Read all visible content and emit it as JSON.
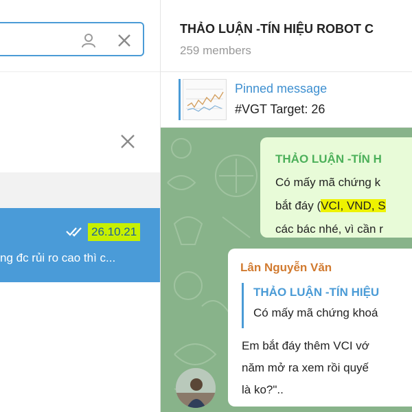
{
  "sidebar": {
    "search": {
      "value": "",
      "placeholder": ""
    },
    "chat_item": {
      "date": "26.10.21",
      "preview": "ng đc rủi ro cao thì c..."
    }
  },
  "chat": {
    "title": "THẢO LUẬN -TÍN HIỆU ROBOT C",
    "members": "259 members",
    "pinned": {
      "label": "Pinned message",
      "text": "#VGT Target: 26"
    },
    "message1": {
      "sender": "THẢO LUẬN -TÍN H",
      "line1": "Có mấy mã chứng k",
      "line2_pre": "bắt đáy (",
      "line2_hl": "VCI, VND, S",
      "line3": "các bác nhé, vì cần r"
    },
    "message2": {
      "sender": "Lân Nguyễn Văn",
      "quote_title": "THẢO LUẬN -TÍN HIỆU",
      "quote_text": "Có mấy mã chứng khoá",
      "line1": "Em bắt đáy thêm VCI vớ",
      "line2": "năm mở ra xem rồi quyế",
      "line3": "là ko?\".."
    }
  },
  "colors": {
    "accent": "#4a9bd6",
    "active_row": "#4a9bd8",
    "date_highlight": "#c7f000",
    "chat_background": "#88b38a",
    "outgoing_bubble": "#e8fbd8",
    "sender_orange": "#d17a2f",
    "highlight_yellow": "#eef200"
  },
  "icons": {
    "search_user": "user-icon",
    "clear_search": "close-icon",
    "close_banner": "close-icon",
    "read_status": "double-check-icon"
  }
}
